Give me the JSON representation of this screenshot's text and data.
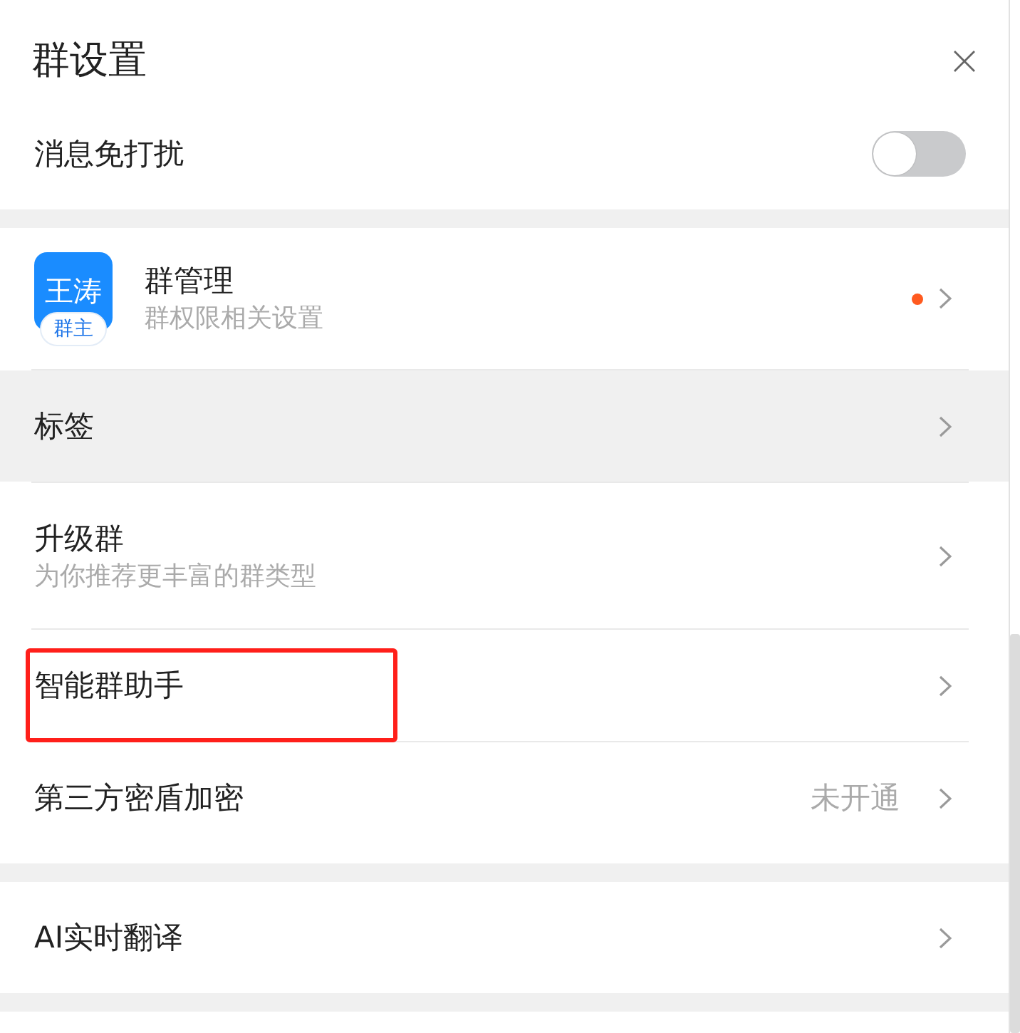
{
  "header": {
    "title": "群设置"
  },
  "sections": [
    {
      "items": [
        {
          "kind": "toggle",
          "label": "消息免打扰",
          "on": false,
          "hovered": false,
          "highlighted": false
        }
      ]
    },
    {
      "items": [
        {
          "kind": "group",
          "avatar": {
            "name": "王涛",
            "badge": "群主"
          },
          "label": "群管理",
          "subtitle": "群权限相关设置",
          "dot": true,
          "hovered": false,
          "highlighted": false
        },
        {
          "kind": "link",
          "label": "标签",
          "dot": false,
          "hovered": true,
          "highlighted": false
        },
        {
          "kind": "link",
          "label": "升级群",
          "subtitle": "为你推荐更丰富的群类型",
          "dot": false,
          "hovered": false,
          "highlighted": false
        },
        {
          "kind": "link",
          "label": "智能群助手",
          "dot": false,
          "hovered": false,
          "highlighted": true
        },
        {
          "kind": "link",
          "label": "第三方密盾加密",
          "value": "未开通",
          "dot": false,
          "hovered": false,
          "highlighted": false
        }
      ]
    },
    {
      "items": [
        {
          "kind": "link",
          "label": "AI实时翻译",
          "dot": false,
          "hovered": false,
          "highlighted": false
        }
      ]
    }
  ]
}
